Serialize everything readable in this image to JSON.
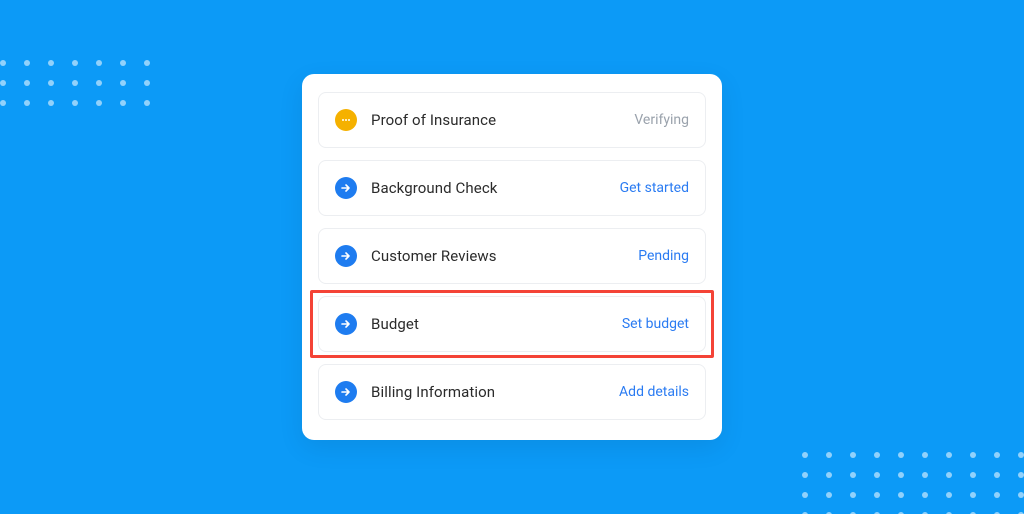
{
  "colors": {
    "background": "#0c9af7",
    "link": "#2a7bf2",
    "muted": "#9aa2ac",
    "highlight": "#f44336",
    "icon_blue": "#1e7cf0",
    "icon_amber": "#f5b100"
  },
  "items": [
    {
      "label": "Proof of Insurance",
      "action": "Verifying",
      "action_style": "muted",
      "icon": "ellipsis-icon",
      "icon_color": "amber",
      "highlighted": false
    },
    {
      "label": "Background Check",
      "action": "Get started",
      "action_style": "link",
      "icon": "arrow-right-icon",
      "icon_color": "blue",
      "highlighted": false
    },
    {
      "label": "Customer Reviews",
      "action": "Pending",
      "action_style": "link",
      "icon": "arrow-right-icon",
      "icon_color": "blue",
      "highlighted": false
    },
    {
      "label": "Budget",
      "action": "Set budget",
      "action_style": "link",
      "icon": "arrow-right-icon",
      "icon_color": "blue",
      "highlighted": true
    },
    {
      "label": "Billing Information",
      "action": "Add details",
      "action_style": "link",
      "icon": "arrow-right-icon",
      "icon_color": "blue",
      "highlighted": false
    }
  ]
}
